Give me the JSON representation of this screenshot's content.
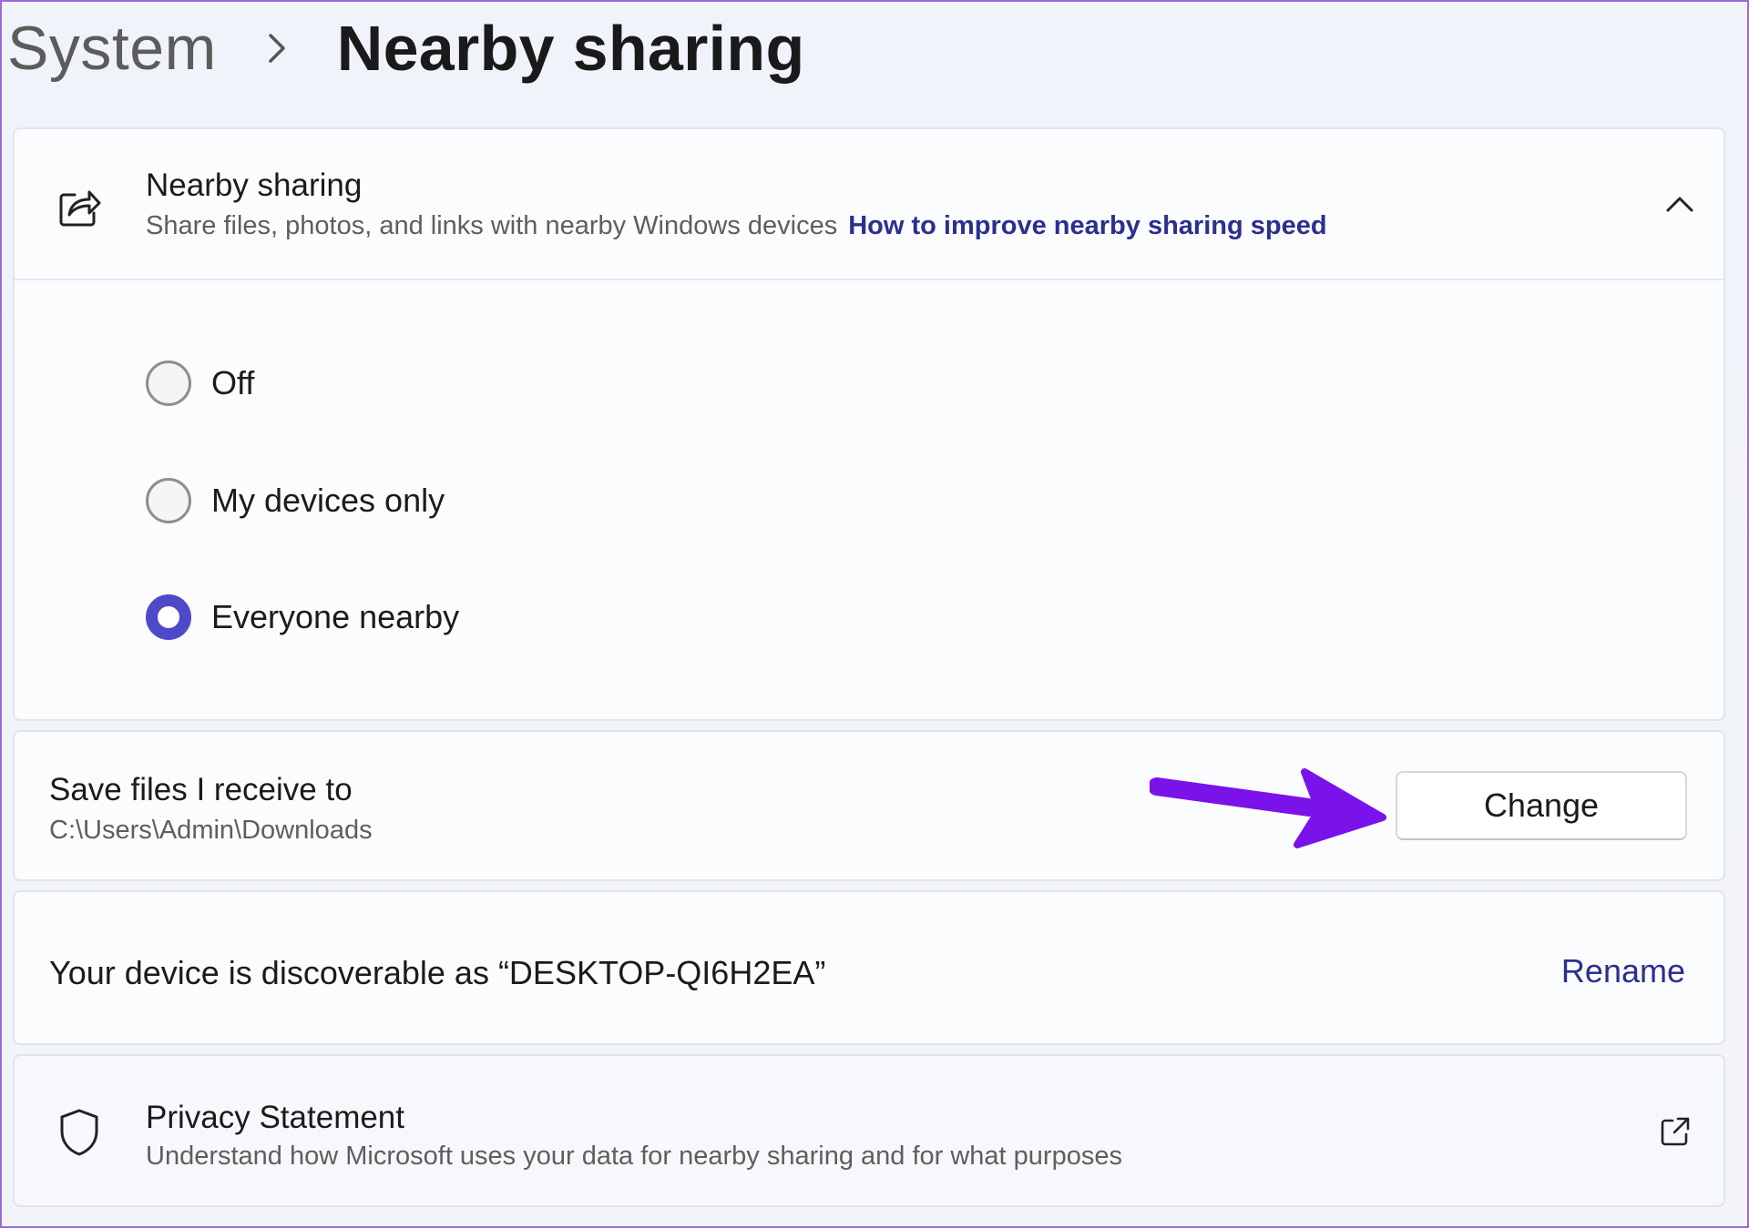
{
  "breadcrumb": {
    "parent": "System",
    "current": "Nearby sharing"
  },
  "nearby_card": {
    "icon": "share-icon",
    "title": "Nearby sharing",
    "subtitle": "Share files, photos, and links with nearby Windows devices",
    "link": "How to improve nearby sharing speed",
    "collapse_icon": "chevron-up-icon",
    "options": [
      {
        "label": "Off",
        "selected": false
      },
      {
        "label": "My devices only",
        "selected": false
      },
      {
        "label": "Everyone nearby",
        "selected": true
      }
    ]
  },
  "save_card": {
    "title": "Save files I receive to",
    "path": "C:\\Users\\Admin\\Downloads",
    "button_label": "Change",
    "annotation": "arrow-pointer-icon"
  },
  "device_card": {
    "text": "Your device is discoverable as “DESKTOP-QI6H2EA”",
    "rename_label": "Rename"
  },
  "privacy_card": {
    "icon": "shield-icon",
    "title": "Privacy Statement",
    "subtitle": "Understand how Microsoft uses your data for nearby sharing and for what purposes",
    "external_icon": "external-link-icon"
  },
  "colors": {
    "accent": "#4e49c9",
    "link": "#2b2f8f",
    "annotation_arrow": "#7a12ea"
  }
}
